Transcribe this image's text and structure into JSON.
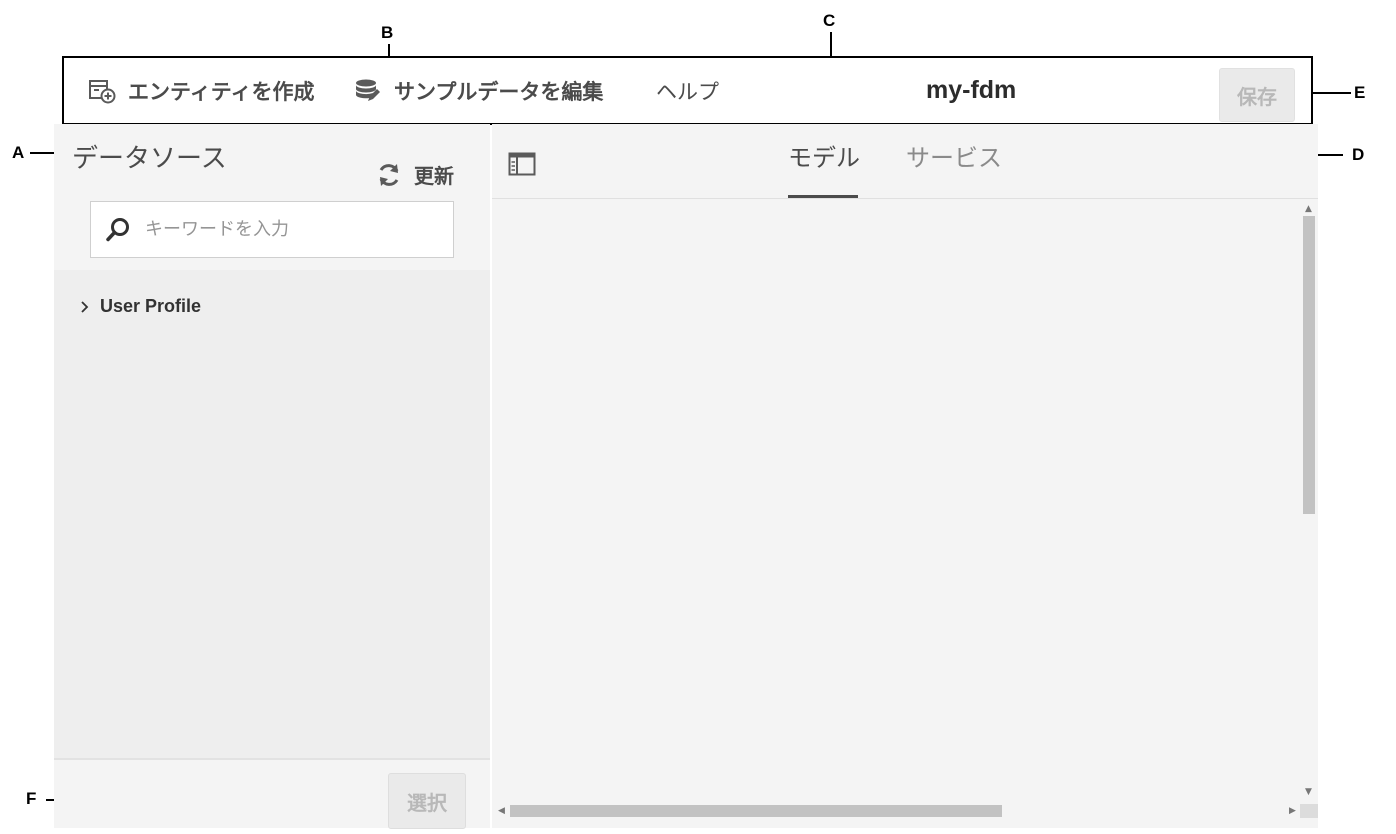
{
  "toolbar": {
    "create_entity_label": "エンティティを作成",
    "edit_sample_data_label": "サンプルデータを編集",
    "help_label": "ヘルプ",
    "model_title": "my-fdm",
    "save_label": "保存"
  },
  "left_panel": {
    "title": "データソース",
    "refresh_label": "更新",
    "search_placeholder": "キーワードを入力",
    "tree_items": [
      {
        "label": "User Profile",
        "icon": "chevron-right-icon"
      }
    ],
    "select_label": "選択"
  },
  "right_panel": {
    "tabs": [
      {
        "label": "モデル",
        "selected": true
      },
      {
        "label": "サービス",
        "selected": false
      }
    ]
  },
  "callouts": {
    "a": "A",
    "b": "B",
    "c": "C",
    "d": "D",
    "e": "E",
    "f": "F"
  },
  "colors": {
    "panel_bg": "#f4f4f4",
    "disabled_button_bg": "#eaeaea",
    "disabled_text": "#b8b8b8",
    "text_primary": "#4b4b4b"
  }
}
